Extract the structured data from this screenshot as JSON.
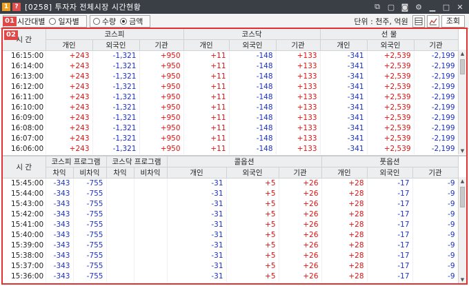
{
  "titlebar": {
    "badge1": "1",
    "badge2": "?",
    "title": "[0258] 투자자 전체시장 시간현황"
  },
  "toolbar": {
    "badge": "01",
    "opt_time": "시간대별",
    "opt_day": "일자별",
    "opt_qty": "수량",
    "opt_amt": "금액",
    "unit": "단위 : 천주, 억원",
    "query": "조회"
  },
  "badge2": "02",
  "top": {
    "time_header": "시  간",
    "groups": [
      "코스피",
      "코스닥",
      "선   물"
    ],
    "sub": [
      "개인",
      "외국인",
      "기관"
    ],
    "rows": [
      {
        "t": "16:15:00",
        "v": [
          "+243",
          "-1,321",
          "+950",
          "+11",
          "-148",
          "+133",
          "-341",
          "+2,539",
          "-2,199"
        ]
      },
      {
        "t": "16:14:00",
        "v": [
          "+243",
          "-1,321",
          "+950",
          "+11",
          "-148",
          "+133",
          "-341",
          "+2,539",
          "-2,199"
        ]
      },
      {
        "t": "16:13:00",
        "v": [
          "+243",
          "-1,321",
          "+950",
          "+11",
          "-148",
          "+133",
          "-341",
          "+2,539",
          "-2,199"
        ]
      },
      {
        "t": "16:12:00",
        "v": [
          "+243",
          "-1,321",
          "+950",
          "+11",
          "-148",
          "+133",
          "-341",
          "+2,539",
          "-2,199"
        ]
      },
      {
        "t": "16:11:00",
        "v": [
          "+243",
          "-1,321",
          "+950",
          "+11",
          "-148",
          "+133",
          "-341",
          "+2,539",
          "-2,199"
        ]
      },
      {
        "t": "16:10:00",
        "v": [
          "+243",
          "-1,321",
          "+950",
          "+11",
          "-148",
          "+133",
          "-341",
          "+2,539",
          "-2,199"
        ]
      },
      {
        "t": "16:09:00",
        "v": [
          "+243",
          "-1,321",
          "+950",
          "+11",
          "-148",
          "+133",
          "-341",
          "+2,539",
          "-2,199"
        ]
      },
      {
        "t": "16:08:00",
        "v": [
          "+243",
          "-1,321",
          "+950",
          "+11",
          "-148",
          "+133",
          "-341",
          "+2,539",
          "-2,199"
        ]
      },
      {
        "t": "16:07:00",
        "v": [
          "+243",
          "-1,321",
          "+950",
          "+11",
          "-148",
          "+133",
          "-341",
          "+2,539",
          "-2,199"
        ]
      },
      {
        "t": "16:06:00",
        "v": [
          "+243",
          "-1,321",
          "+950",
          "+11",
          "-148",
          "+133",
          "-341",
          "+2,539",
          "-2,199"
        ]
      }
    ]
  },
  "bottom": {
    "time_header": "시  간",
    "groups": [
      "코스피 프로그램",
      "코스닥 프로그램",
      "콜옵션",
      "풋옵션"
    ],
    "prog_sub": [
      "차익",
      "비차익"
    ],
    "sub": [
      "개인",
      "외국인",
      "기관"
    ],
    "rows": [
      {
        "t": "15:45:00",
        "v": [
          "-343",
          "-755",
          "",
          "",
          "-31",
          "+5",
          "+26",
          "+28",
          "-17",
          "-9"
        ]
      },
      {
        "t": "15:44:00",
        "v": [
          "-343",
          "-755",
          "",
          "",
          "-31",
          "+5",
          "+26",
          "+28",
          "-17",
          "-9"
        ]
      },
      {
        "t": "15:43:00",
        "v": [
          "-343",
          "-755",
          "",
          "",
          "-31",
          "+5",
          "+26",
          "+28",
          "-17",
          "-9"
        ]
      },
      {
        "t": "15:42:00",
        "v": [
          "-343",
          "-755",
          "",
          "",
          "-31",
          "+5",
          "+26",
          "+28",
          "-17",
          "-9"
        ]
      },
      {
        "t": "15:41:00",
        "v": [
          "-343",
          "-755",
          "",
          "",
          "-31",
          "+5",
          "+26",
          "+28",
          "-17",
          "-9"
        ]
      },
      {
        "t": "15:40:00",
        "v": [
          "-343",
          "-755",
          "",
          "",
          "-31",
          "+5",
          "+26",
          "+28",
          "-17",
          "-9"
        ]
      },
      {
        "t": "15:39:00",
        "v": [
          "-343",
          "-755",
          "",
          "",
          "-31",
          "+5",
          "+26",
          "+28",
          "-17",
          "-9"
        ]
      },
      {
        "t": "15:38:00",
        "v": [
          "-343",
          "-755",
          "",
          "",
          "-31",
          "+5",
          "+26",
          "+28",
          "-17",
          "-9"
        ]
      },
      {
        "t": "15:37:00",
        "v": [
          "-343",
          "-755",
          "",
          "",
          "-31",
          "+5",
          "+26",
          "+28",
          "-17",
          "-9"
        ]
      },
      {
        "t": "15:36:00",
        "v": [
          "-343",
          "-755",
          "",
          "",
          "-31",
          "+5",
          "+26",
          "+28",
          "-17",
          "-9"
        ]
      }
    ]
  },
  "colors": {
    "positive": "#e01010",
    "negative": "#1a30c8",
    "highlight": "#e03030"
  }
}
